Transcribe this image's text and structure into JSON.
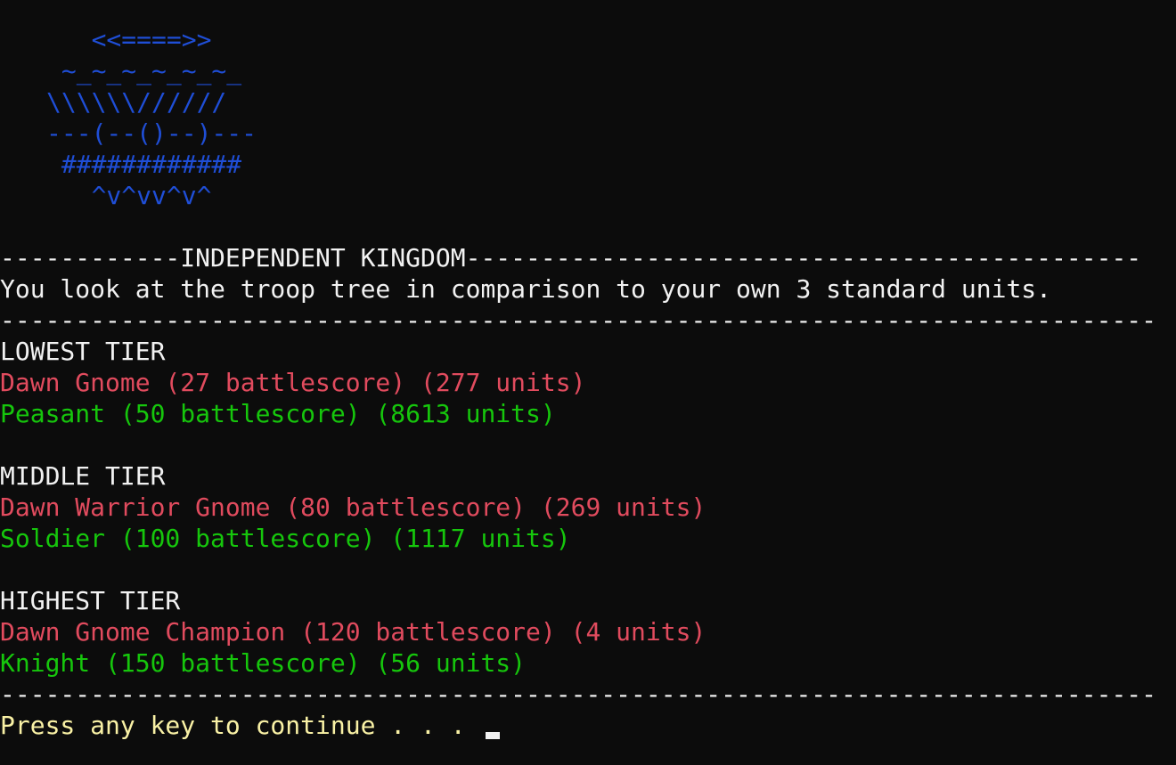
{
  "ascii_art": [
    "   <<====>>",
    " ~_~_~_~_~_~_",
    "\\\\\\\\\\\\//////",
    "---(--()--)---",
    " ############",
    "   ^v^vv^v^"
  ],
  "header_rule": "------------INDEPENDENT KINGDOM---------------------------------------------",
  "intro_text": "You look at the troop tree in comparison to your own 3 standard units.",
  "rule": "-----------------------------------------------------------------------------",
  "tiers": [
    {
      "title": "LOWEST TIER",
      "enemy": "Dawn Gnome (27 battlescore) (277 units)",
      "own": "Peasant (50 battlescore) (8613 units)"
    },
    {
      "title": "MIDDLE TIER",
      "enemy": "Dawn Warrior Gnome (80 battlescore) (269 units)",
      "own": "Soldier (100 battlescore) (1117 units)"
    },
    {
      "title": "HIGHEST TIER",
      "enemy": "Dawn Gnome Champion (120 battlescore) (4 units)",
      "own": "Knight (150 battlescore) (56 units)"
    }
  ],
  "prompt": "Press any key to continue . . .",
  "colors": {
    "background": "#0c0c0c",
    "art": "#1f4ed6",
    "enemy": "#e14b5e",
    "own": "#16c60c",
    "prompt": "#f9f1a5"
  }
}
